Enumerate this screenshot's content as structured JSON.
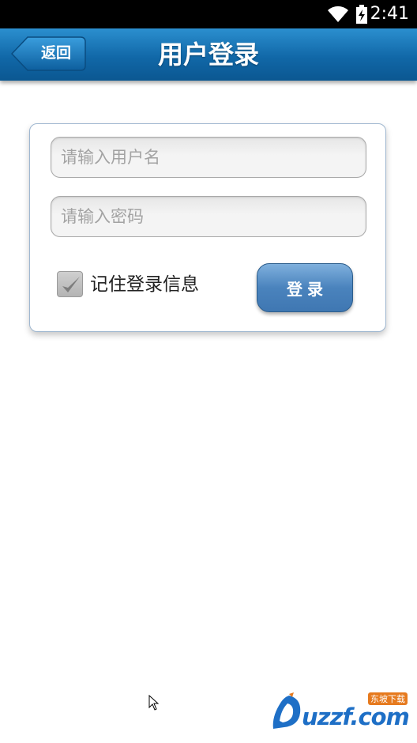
{
  "status_bar": {
    "time": "2:41"
  },
  "header": {
    "back_label": "返回",
    "title": "用户登录"
  },
  "login_form": {
    "username_placeholder": "请输入用户名",
    "password_placeholder": "请输入密码",
    "remember_label": "记住登录信息",
    "remember_checked": true,
    "login_label": "登录"
  },
  "watermark": {
    "text": "uzzf.com",
    "tag": "东坡下载"
  },
  "colors": {
    "header_blue": "#1168a8",
    "button_blue": "#4a83bd",
    "watermark_blue": "#1e6fc6",
    "watermark_orange": "#e67a1e"
  }
}
